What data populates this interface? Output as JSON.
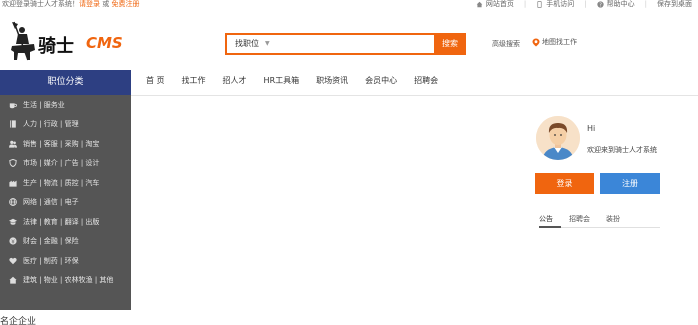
{
  "topbar": {
    "welcome_text": "欢迎登录骑士人才系统！",
    "login_link": "请登录",
    "or_text": " 或 ",
    "register_link": "免费注册",
    "links": [
      {
        "icon": "home-icon",
        "label": "网站首页"
      },
      {
        "icon": "mobile-icon",
        "label": "手机访问"
      },
      {
        "icon": "help-icon",
        "label": "帮助中心"
      },
      {
        "icon": "",
        "label": "保存到桌面"
      }
    ]
  },
  "header": {
    "brand_text": "骑士",
    "brand_suffix": "CMS",
    "search": {
      "select_label": "找职位",
      "placeholder": "",
      "button_label": "搜索"
    },
    "advanced_search": "高级搜索",
    "map_job": "地图找工作"
  },
  "nav": {
    "category_title": "职位分类",
    "items": [
      "首 页",
      "找工作",
      "招人才",
      "HR工具箱",
      "职场资讯",
      "会员中心",
      "招聘会"
    ]
  },
  "sidebar": {
    "items": [
      {
        "icon": "coffee-icon",
        "label": "生活 | 服务业"
      },
      {
        "icon": "book-icon",
        "label": "人力 | 行政 | 管理"
      },
      {
        "icon": "people-icon",
        "label": "销售 | 客服 | 采购 | 淘宝"
      },
      {
        "icon": "shield-icon",
        "label": "市场 | 媒介 | 广告 | 设计"
      },
      {
        "icon": "factory-icon",
        "label": "生产 | 物流 | 质控 | 汽车"
      },
      {
        "icon": "globe-icon",
        "label": "网络 | 通信 | 电子"
      },
      {
        "icon": "graduation-icon",
        "label": "法律 | 教育 | 翻译 | 出版"
      },
      {
        "icon": "yen-icon",
        "label": "财会 | 金融 | 保险"
      },
      {
        "icon": "heart-icon",
        "label": "医疗 | 制药 | 环保"
      },
      {
        "icon": "house-icon",
        "label": "建筑 | 物业 | 农林牧渔 | 其他"
      }
    ]
  },
  "section_title": "名企企业",
  "user_panel": {
    "greeting": "Hi",
    "welcome": "欢迎来到骑士人才系统",
    "login_button": "登录",
    "register_button": "注册",
    "tabs": [
      "公告",
      "招聘会",
      "装扮"
    ]
  },
  "colors": {
    "accent": "#f0650f",
    "nav_blue": "#2d3f82",
    "sidebar_bg": "#555555",
    "register_blue": "#3b86d8"
  }
}
